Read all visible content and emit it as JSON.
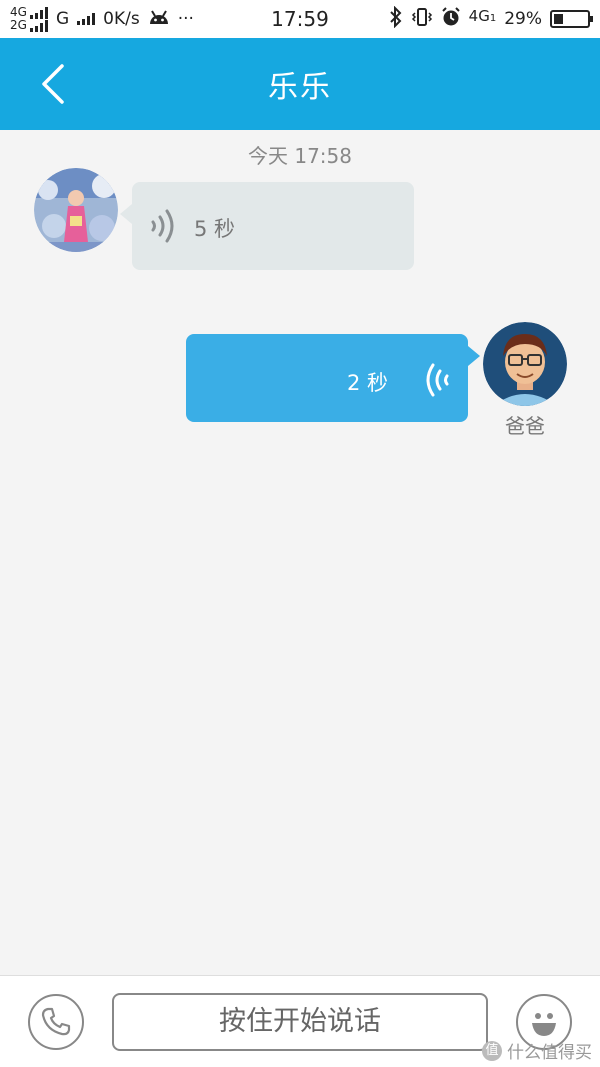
{
  "status_bar": {
    "net1": "4G",
    "net2": "2G",
    "net3": "G",
    "speed": "0K/s",
    "more": "···",
    "time": "17:59",
    "net4": "4G",
    "net4_sub": "1",
    "battery_text": "29%",
    "battery_level_percent": 29
  },
  "header": {
    "title": "乐乐",
    "back_icon": "chevron-left-icon",
    "background_color": "#16a8e0"
  },
  "chat": {
    "timestamp": "今天 17:58",
    "messages": [
      {
        "direction": "incoming",
        "type": "voice",
        "duration": "5 秒",
        "avatar": "child-photo-avatar"
      },
      {
        "direction": "outgoing",
        "type": "voice",
        "duration": "2 秒",
        "avatar": "cartoon-dad-avatar",
        "sender": "爸爸"
      }
    ]
  },
  "bottom_bar": {
    "call_icon": "phone-icon",
    "talk_label": "按住开始说话",
    "emoji_icon": "smiley-icon"
  },
  "watermark": {
    "badge": "值",
    "text": "什么值得买"
  },
  "colors": {
    "accent": "#16a8e0",
    "outgoing_bubble": "#3aaee6",
    "incoming_bubble": "#e2e8e9",
    "background": "#f4f4f4"
  }
}
